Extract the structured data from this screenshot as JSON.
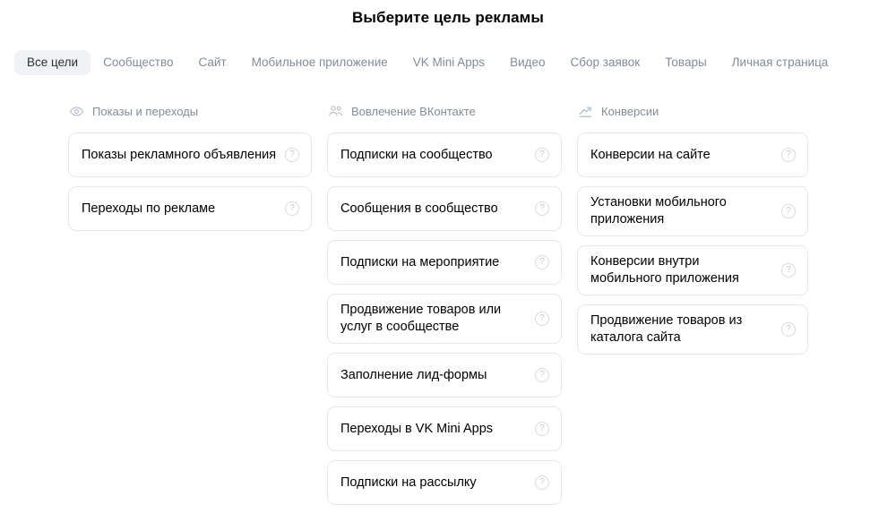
{
  "page": {
    "title": "Выберите цель рекламы"
  },
  "tabs": [
    {
      "label": "Все цели",
      "active": true
    },
    {
      "label": "Сообщество",
      "active": false
    },
    {
      "label": "Сайт",
      "active": false
    },
    {
      "label": "Мобильное приложение",
      "active": false
    },
    {
      "label": "VK Mini Apps",
      "active": false
    },
    {
      "label": "Видео",
      "active": false
    },
    {
      "label": "Сбор заявок",
      "active": false
    },
    {
      "label": "Товары",
      "active": false
    },
    {
      "label": "Личная страница",
      "active": false
    }
  ],
  "columns": [
    {
      "icon": "eye-icon",
      "header": "Показы и переходы",
      "cards": [
        {
          "label": "Показы рекламного объявления",
          "help": "?"
        },
        {
          "label": "Переходы по рекламе",
          "help": "?"
        }
      ]
    },
    {
      "icon": "people-icon",
      "header": "Вовлечение ВКонтакте",
      "cards": [
        {
          "label": "Подписки на сообщество",
          "help": "?"
        },
        {
          "label": "Сообщения в сообщество",
          "help": "?"
        },
        {
          "label": "Подписки на мероприятие",
          "help": "?"
        },
        {
          "label": "Продвижение товаров или услуг в сообществе",
          "help": "?"
        },
        {
          "label": "Заполнение лид-формы",
          "help": "?"
        },
        {
          "label": "Переходы в VK Mini Apps",
          "help": "?"
        },
        {
          "label": "Подписки на рассылку",
          "help": "?"
        }
      ]
    },
    {
      "icon": "trending-up-icon",
      "header": "Конверсии",
      "cards": [
        {
          "label": "Конверсии на сайте",
          "help": "?"
        },
        {
          "label": "Установки мобильного приложения",
          "help": "?"
        },
        {
          "label": "Конверсии внутри мобильного приложения",
          "help": "?"
        },
        {
          "label": "Продвижение товаров из каталога сайта",
          "help": "?"
        }
      ]
    }
  ],
  "colors": {
    "background": "#ffffff",
    "text": "#000000",
    "muted": "#818c99",
    "card_border": "#e7e8ec",
    "active_tab_bg": "#f0f2f5",
    "icon": "#b8c1cc"
  }
}
